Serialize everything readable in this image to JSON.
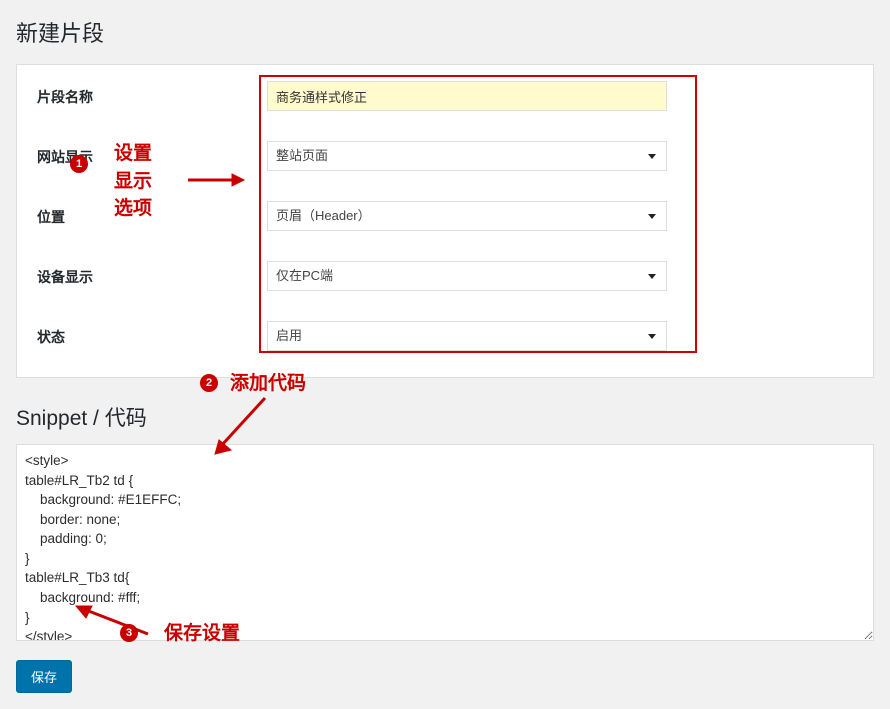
{
  "page": {
    "title": "新建片段"
  },
  "form": {
    "name_label": "片段名称",
    "name_value": "商务通样式修正",
    "site_label": "网站显示",
    "site_value": "整站页面",
    "position_label": "位置",
    "position_value": "页眉（Header）",
    "device_label": "设备显示",
    "device_value": "仅在PC端",
    "status_label": "状态",
    "status_value": "启用"
  },
  "snippet": {
    "title": "Snippet / 代码",
    "code": "<style>\ntable#LR_Tb2 td {\n    background: #E1EFFC;\n    border: none;\n    padding: 0;\n}\ntable#LR_Tb3 td{\n    background: #fff;\n}\n</style>"
  },
  "actions": {
    "save": "保存"
  },
  "annotations": {
    "b1": "1",
    "t1": "设置\n显示\n选项",
    "b2": "2",
    "t2": "添加代码",
    "b3": "3",
    "t3": "保存设置"
  }
}
